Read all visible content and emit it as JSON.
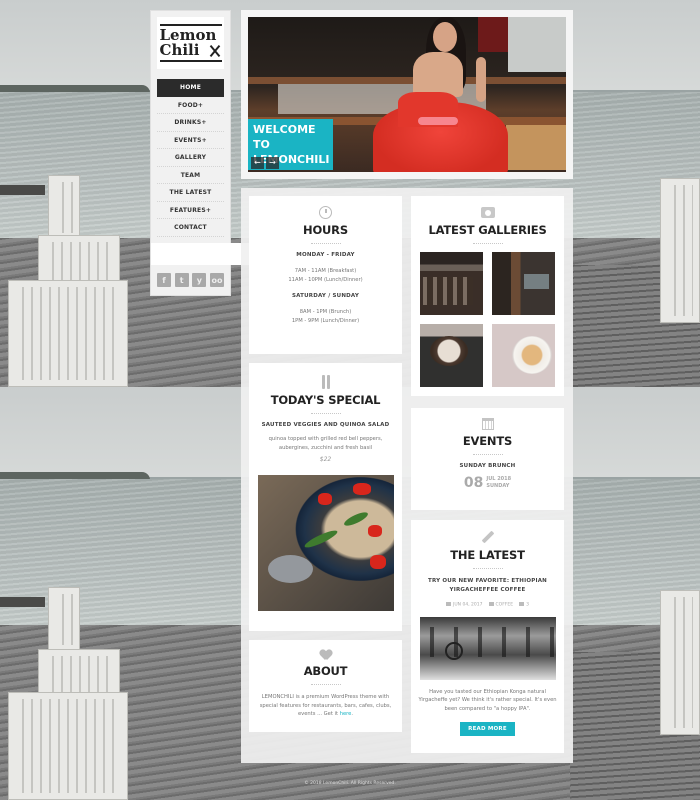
{
  "brand": {
    "logo_line1": "Lemon",
    "logo_line2": "Chili",
    "accent_color": "#1ab4c4"
  },
  "nav": {
    "items": [
      {
        "label": "HOME",
        "active": true
      },
      {
        "label": "FOOD+"
      },
      {
        "label": "DRINKS+"
      },
      {
        "label": "EVENTS+"
      },
      {
        "label": "GALLERY"
      },
      {
        "label": "TEAM"
      },
      {
        "label": "THE LATEST"
      },
      {
        "label": "FEATURES+"
      },
      {
        "label": "CONTACT"
      }
    ]
  },
  "search": {
    "value": "",
    "placeholder": "",
    "button_icon": "search-icon"
  },
  "social": [
    {
      "icon": "facebook-icon",
      "glyph": "f"
    },
    {
      "icon": "twitter-icon",
      "glyph": "t"
    },
    {
      "icon": "yelp-icon",
      "glyph": "y"
    },
    {
      "icon": "tripadvisor-icon",
      "glyph": "oo"
    }
  ],
  "slider": {
    "caption_line1": "WELCOME TO",
    "caption_line2": "LEMONCHILI",
    "prev_glyph": "←",
    "next_glyph": "→"
  },
  "hours": {
    "icon": "clock-icon",
    "title": "HOURS",
    "weekday_label": "MONDAY - FRIDAY",
    "weekday_lines": [
      "7AM - 11AM (Breakfast)",
      "11AM - 10PM (Lunch/Dinner)"
    ],
    "weekend_label": "SATURDAY / SUNDAY",
    "weekend_lines": [
      "8AM - 1PM (Brunch)",
      "1PM - 9PM (Lunch/Dinner)"
    ]
  },
  "galleries": {
    "icon": "camera-icon",
    "title": "LATEST GALLERIES",
    "thumbs": [
      "coffee-bean-jars",
      "cafe-interior",
      "soup-bowl",
      "latte-art"
    ]
  },
  "special": {
    "icon": "cutlery-icon",
    "title": "TODAY'S SPECIAL",
    "dish": "SAUTEED VEGGIES AND QUINOA SALAD",
    "description": "quinoa topped with grilled red bell peppers, aubergines, zucchini and fresh basil",
    "price": "$22"
  },
  "events": {
    "icon": "calendar-icon",
    "title": "EVENTS",
    "event_name": "SUNDAY BRUNCH",
    "day": "08",
    "month_year": "JUL 2018",
    "weekday": "SUNDAY"
  },
  "latest": {
    "icon": "pencil-icon",
    "title": "THE LATEST",
    "post_title": "TRY OUR NEW FAVORITE: ETHIOPIAN YIRGACHEFFEE COFFEE",
    "date": "JUN 04, 2017",
    "category": "COFFEE",
    "comments": "3",
    "excerpt": "Have you tasted our Ethiopian Konga natural Yirgacheffe yet? We think it's rather special. It's even been compared to \"a hoppy IPA\".",
    "read_more": "READ MORE"
  },
  "about": {
    "icon": "heart-icon",
    "title": "ABOUT",
    "text": "LEMONCHILI is a premium WordPress theme with special features for restaurants, bars, cafes, clubs, events ... Get it ",
    "link_text": "here",
    "text_end": "."
  },
  "footer": {
    "text": "© 2018 LemonChili. All Rights Reserved."
  }
}
